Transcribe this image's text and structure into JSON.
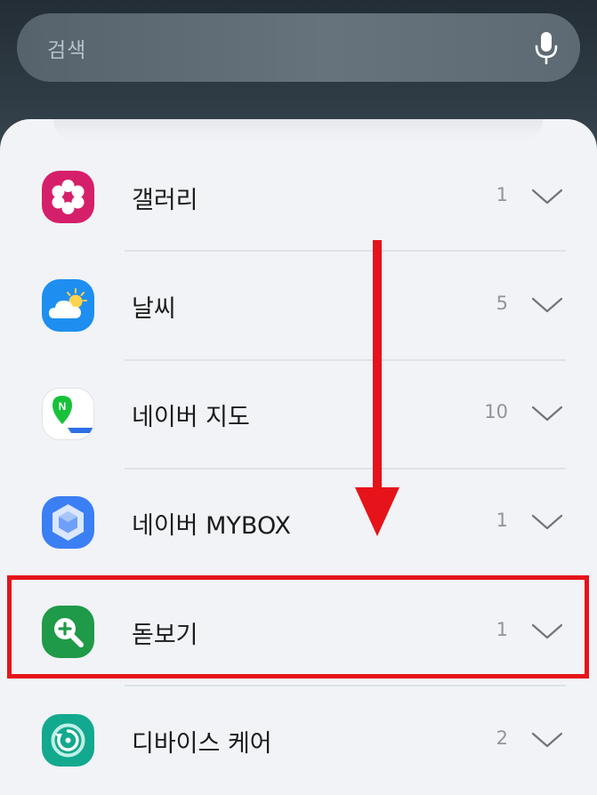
{
  "search": {
    "placeholder": "검색",
    "icon": "mic-icon"
  },
  "apps": [
    {
      "name": "갤러리",
      "count": "1",
      "icon": "gallery-icon",
      "color": "#d61f6a"
    },
    {
      "name": "날씨",
      "count": "5",
      "icon": "weather-icon",
      "color": "#1e8ff0"
    },
    {
      "name": "네이버 지도",
      "count": "10",
      "icon": "naver-map-icon",
      "color": "#ffffff"
    },
    {
      "name": "네이버 MYBOX",
      "count": "1",
      "icon": "naver-mybox-icon",
      "color": "#3b7ff4"
    },
    {
      "name": "돋보기",
      "count": "1",
      "icon": "magnifier-icon",
      "color": "#1f9a48"
    },
    {
      "name": "디바이스 케어",
      "count": "2",
      "icon": "device-care-icon",
      "color": "#12a98f"
    }
  ],
  "highlighted_app": "돋보기",
  "annotation_color": "#e6131a"
}
